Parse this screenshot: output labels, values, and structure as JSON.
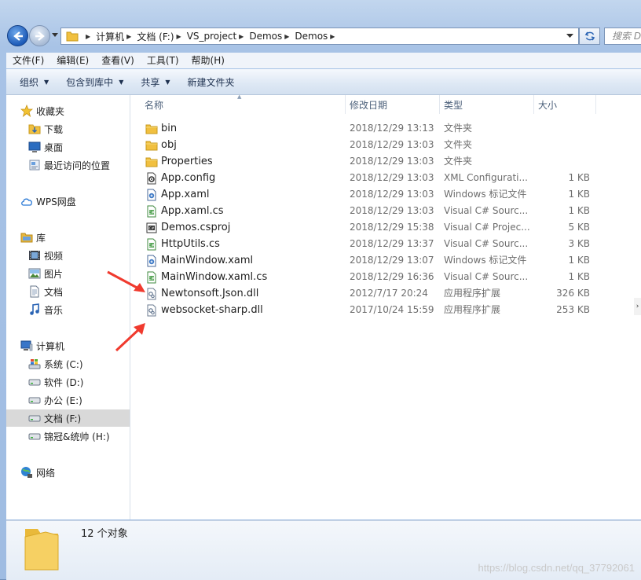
{
  "window": {
    "frame_color": "#a8c3e6"
  },
  "address_bar": {
    "crumbs": [
      "计算机",
      "文档 (F:)",
      "VS_project",
      "Demos",
      "Demos"
    ],
    "search_placeholder": "搜索 D"
  },
  "menu": [
    "文件(F)",
    "编辑(E)",
    "查看(V)",
    "工具(T)",
    "帮助(H)"
  ],
  "toolbar": [
    {
      "label": "组织",
      "has_dropdown": true
    },
    {
      "label": "包含到库中",
      "has_dropdown": true
    },
    {
      "label": "共享",
      "has_dropdown": true
    },
    {
      "label": "新建文件夹",
      "has_dropdown": false
    }
  ],
  "nav": [
    {
      "label": "收藏夹",
      "icon": "star-icon"
    },
    {
      "label": "下载",
      "icon": "download-folder-icon"
    },
    {
      "label": "桌面",
      "icon": "desktop-icon"
    },
    {
      "label": "最近访问的位置",
      "icon": "recent-places-icon"
    },
    {
      "label": "WPS网盘",
      "icon": "cloud-icon"
    },
    {
      "label": "库",
      "icon": "library-icon"
    },
    {
      "label": "视频",
      "icon": "video-icon"
    },
    {
      "label": "图片",
      "icon": "picture-icon"
    },
    {
      "label": "文档",
      "icon": "document-icon"
    },
    {
      "label": "音乐",
      "icon": "music-icon"
    },
    {
      "label": "计算机",
      "icon": "computer-icon"
    },
    {
      "label": "系统 (C:)",
      "icon": "system-drive-icon"
    },
    {
      "label": "软件 (D:)",
      "icon": "drive-icon"
    },
    {
      "label": "办公 (E:)",
      "icon": "drive-icon"
    },
    {
      "label": "文档 (F:)",
      "icon": "drive-icon",
      "selected": true
    },
    {
      "label": "锦冠&统帅 (H:)",
      "icon": "drive-icon"
    },
    {
      "label": "网络",
      "icon": "network-icon"
    }
  ],
  "columns": [
    "名称",
    "修改日期",
    "类型",
    "大小"
  ],
  "files": [
    {
      "name": "bin",
      "date": "2018/12/29 13:13",
      "type": "文件夹",
      "size": "",
      "icon": "folder-icon"
    },
    {
      "name": "obj",
      "date": "2018/12/29 13:03",
      "type": "文件夹",
      "size": "",
      "icon": "folder-icon"
    },
    {
      "name": "Properties",
      "date": "2018/12/29 13:03",
      "type": "文件夹",
      "size": "",
      "icon": "folder-icon"
    },
    {
      "name": "App.config",
      "date": "2018/12/29 13:03",
      "type": "XML Configurati...",
      "size": "1 KB",
      "icon": "config-file-icon"
    },
    {
      "name": "App.xaml",
      "date": "2018/12/29 13:03",
      "type": "Windows 标记文件",
      "size": "1 KB",
      "icon": "xaml-file-icon"
    },
    {
      "name": "App.xaml.cs",
      "date": "2018/12/29 13:03",
      "type": "Visual C# Sourc...",
      "size": "1 KB",
      "icon": "csharp-file-icon"
    },
    {
      "name": "Demos.csproj",
      "date": "2018/12/29 15:38",
      "type": "Visual C# Projec...",
      "size": "5 KB",
      "icon": "csproj-file-icon"
    },
    {
      "name": "HttpUtils.cs",
      "date": "2018/12/29 13:37",
      "type": "Visual C# Sourc...",
      "size": "3 KB",
      "icon": "csharp-file-icon"
    },
    {
      "name": "MainWindow.xaml",
      "date": "2018/12/29 13:07",
      "type": "Windows 标记文件",
      "size": "1 KB",
      "icon": "xaml-file-icon"
    },
    {
      "name": "MainWindow.xaml.cs",
      "date": "2018/12/29 16:36",
      "type": "Visual C# Sourc...",
      "size": "1 KB",
      "icon": "csharp-file-icon"
    },
    {
      "name": "Newtonsoft.Json.dll",
      "date": "2012/7/17 20:24",
      "type": "应用程序扩展",
      "size": "326 KB",
      "icon": "dll-file-icon"
    },
    {
      "name": "websocket-sharp.dll",
      "date": "2017/10/24 15:59",
      "type": "应用程序扩展",
      "size": "253 KB",
      "icon": "dll-file-icon"
    }
  ],
  "status": {
    "count": "12 个对象"
  },
  "watermark": "https://blog.csdn.net/qq_37792061",
  "annotation_color": "#f03a2e"
}
